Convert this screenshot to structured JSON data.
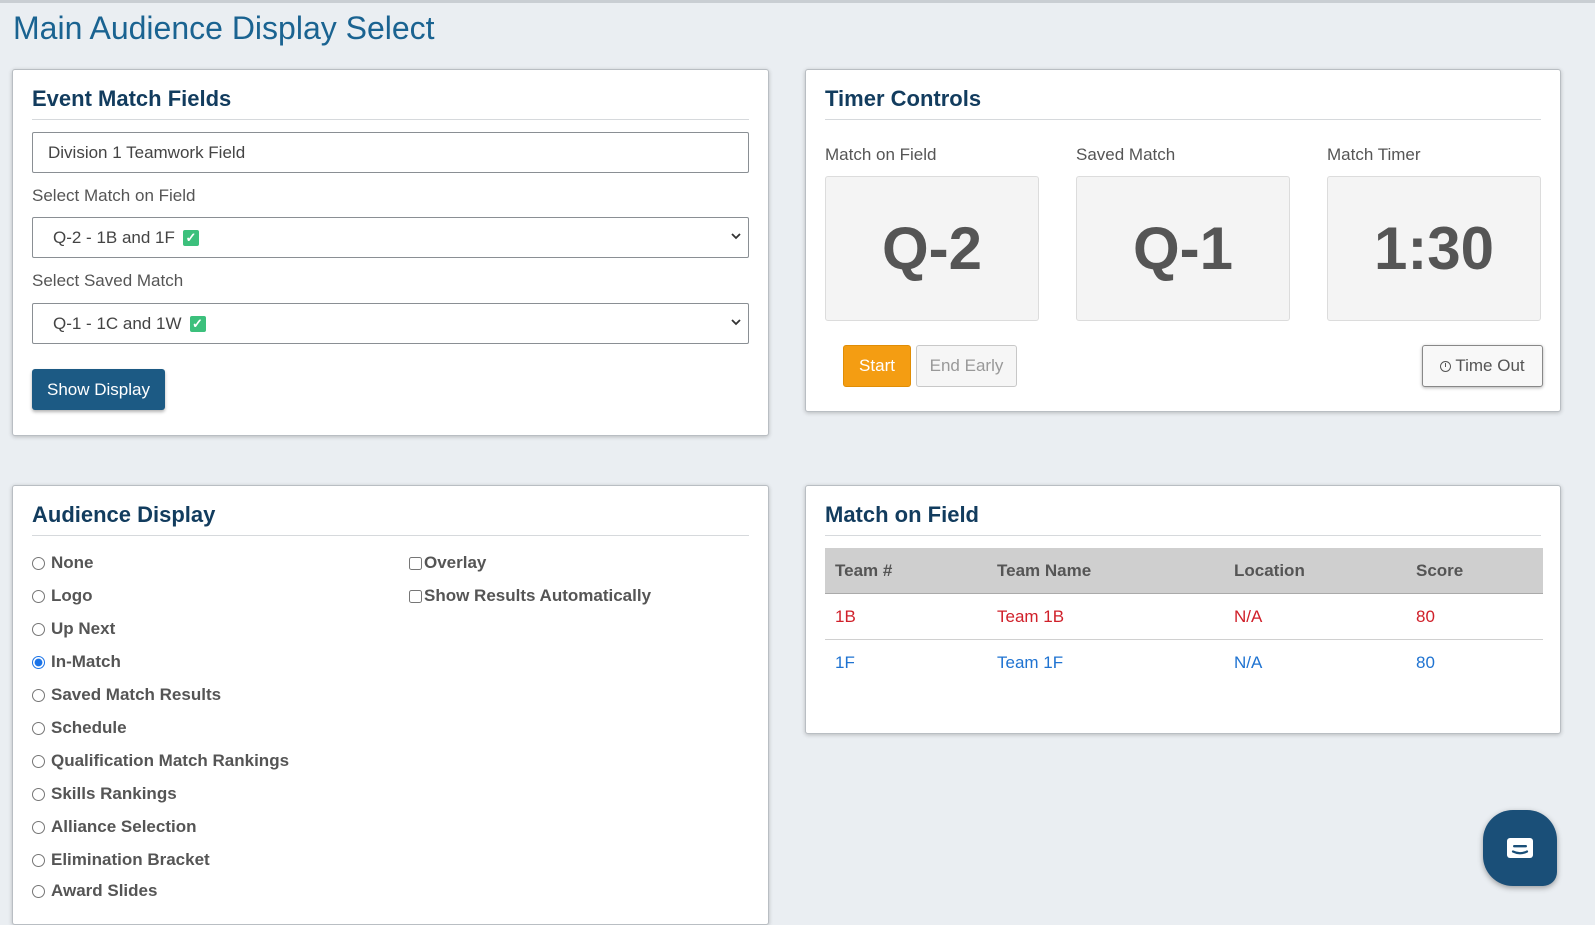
{
  "page_title": "Main Audience Display Select",
  "event_match_fields": {
    "title": "Event Match Fields",
    "field_value": "Division 1 Teamwork Field",
    "select_match_label": "Select Match on Field",
    "select_match_value": "Q-2 - 1B and 1F",
    "select_saved_label": "Select Saved Match",
    "select_saved_value": "Q-1 - 1C and 1W",
    "show_display_label": "Show Display"
  },
  "timer_controls": {
    "title": "Timer Controls",
    "match_on_field_label": "Match on Field",
    "match_on_field_value": "Q-2",
    "saved_match_label": "Saved Match",
    "saved_match_value": "Q-1",
    "match_timer_label": "Match Timer",
    "match_timer_value": "1:30",
    "start_label": "Start",
    "end_early_label": "End Early",
    "time_out_label": "Time Out"
  },
  "audience_display": {
    "title": "Audience Display",
    "options": [
      {
        "label": "None",
        "checked": false
      },
      {
        "label": "Logo",
        "checked": false
      },
      {
        "label": "Up Next",
        "checked": false
      },
      {
        "label": "In-Match",
        "checked": true
      },
      {
        "label": "Saved Match Results",
        "checked": false
      },
      {
        "label": "Schedule",
        "checked": false
      },
      {
        "label": "Qualification Match Rankings",
        "checked": false
      },
      {
        "label": "Skills Rankings",
        "checked": false
      },
      {
        "label": "Alliance Selection",
        "checked": false
      },
      {
        "label": "Elimination Bracket",
        "checked": false
      },
      {
        "label": "Award Slides",
        "checked": false
      }
    ],
    "checkboxes": [
      {
        "label": "Overlay",
        "checked": false
      },
      {
        "label": "Show Results Automatically",
        "checked": false
      }
    ]
  },
  "match_on_field": {
    "title": "Match on Field",
    "headers": [
      "Team #",
      "Team Name",
      "Location",
      "Score"
    ],
    "rows": [
      {
        "team": "1B",
        "name": "Team 1B",
        "location": "N/A",
        "score": "80",
        "alliance": "red"
      },
      {
        "team": "1F",
        "name": "Team 1F",
        "location": "N/A",
        "score": "80",
        "alliance": "blue"
      }
    ]
  },
  "colors": {
    "accent": "#1c5a84",
    "title_blue": "#1a6391",
    "start_orange": "#f49d12",
    "red_alliance": "#d0202a",
    "blue_alliance": "#1f73d1",
    "check_green": "#3cc07c"
  },
  "icons": {
    "check": "check-icon",
    "chevron": "chevron-down-icon",
    "clock": "clock-icon",
    "chat": "chat-icon"
  }
}
